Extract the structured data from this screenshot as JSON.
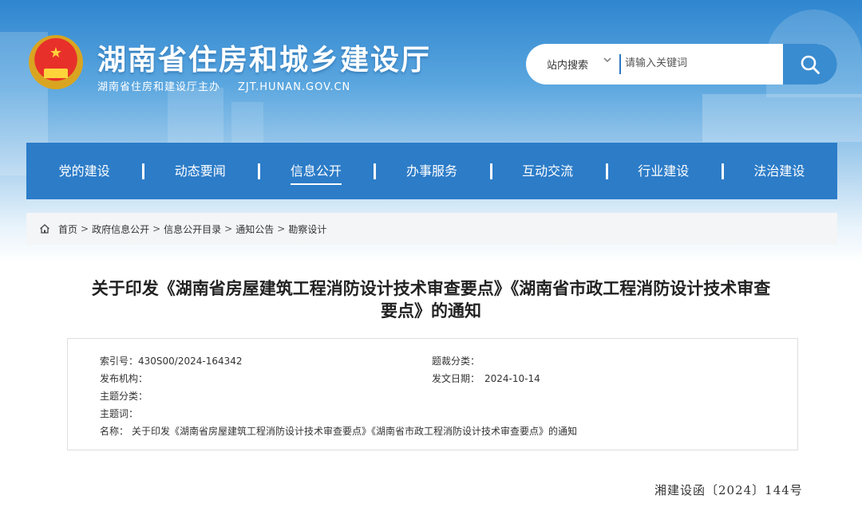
{
  "header": {
    "site_title": "湖南省住房和城乡建设厅",
    "sponsor": "湖南省住房和建设厅主办",
    "domain": "ZJT.HUNAN.GOV.CN"
  },
  "search": {
    "scope": "站内搜索",
    "placeholder": "请输入关键词",
    "value": "",
    "icon": "search-icon"
  },
  "nav": {
    "items": [
      {
        "label": "党的建设"
      },
      {
        "label": "动态要闻"
      },
      {
        "label": "信息公开",
        "active": true
      },
      {
        "label": "办事服务"
      },
      {
        "label": "互动交流"
      },
      {
        "label": "行业建设"
      },
      {
        "label": "法治建设"
      }
    ]
  },
  "breadcrumb": {
    "items": [
      "首页",
      "政府信息公开",
      "信息公开目录",
      "通知公告",
      "勘察设计"
    ]
  },
  "article": {
    "title_line1": "关于印发《湖南省房屋建筑工程消防设计技术审查要点》《湖南省市政工程消防设计技术审查",
    "title_line2": "要点》的通知",
    "meta": {
      "index_label": "索引号：",
      "index_value": "430S00/2024-164342",
      "category_label": "题裁分类：",
      "category_value": "",
      "publisher_label": "发布机构：",
      "publisher_value": "",
      "date_label": "发文日期：",
      "date_value": "2024-10-14",
      "topic_label": "主题分类：",
      "topic_value": "",
      "keywords_label": "主题词：",
      "keywords_value": "",
      "name_label": "名称：",
      "name_value": "关于印发《湖南省房屋建筑工程消防设计技术审查要点》《湖南省市政工程消防设计技术审查要点》的通知"
    },
    "doc_number": "湘建设函〔2024〕144号"
  },
  "colors": {
    "nav_bg": "#2c7cc8",
    "search_button": "#3a8cd0",
    "breadcrumb_bg": "#f4f5f7"
  }
}
